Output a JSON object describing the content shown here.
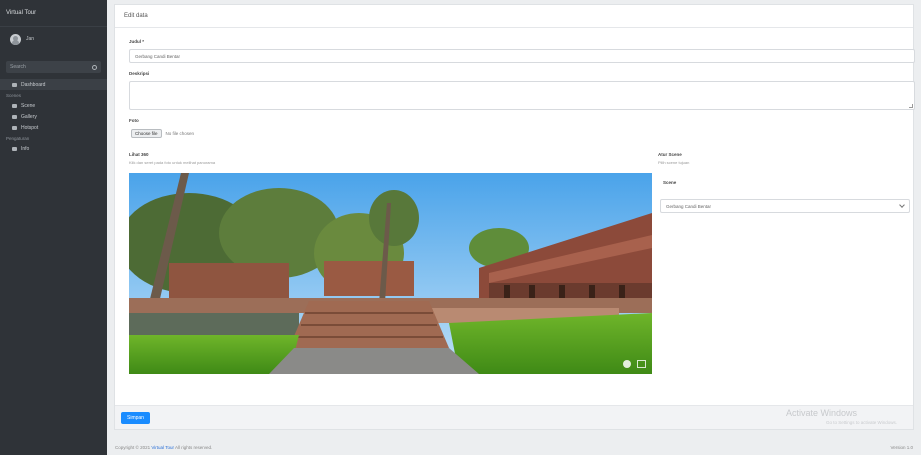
{
  "sidebar": {
    "brand": "Virtual Tour",
    "user": "Jan",
    "search_placeholder": "Search",
    "items": [
      {
        "label": "Dashboard",
        "icon": "dashboard-icon"
      },
      {
        "label": "Scenes",
        "icon": "section-heading"
      },
      {
        "label": "Scene",
        "icon": "image-icon"
      },
      {
        "label": "Gallery",
        "icon": "gallery-icon"
      },
      {
        "label": "Hotspot",
        "icon": "pin-icon"
      },
      {
        "label": "Pengaturan",
        "icon": "section-heading"
      },
      {
        "label": "Info",
        "icon": "info-icon"
      }
    ]
  },
  "card": {
    "title": "Edit data",
    "judul_label": "Judul *",
    "judul_value": "Gerbang Candi Bentar",
    "deskripsi_label": "Deskripsi",
    "foto_label": "Foto",
    "file_button": "Choose file",
    "file_text": "No file chosen",
    "preview_label": "Lihat 360",
    "preview_sub": "Klik dan seret pada foto untuk melihat panorama",
    "side_label": "Atur Scene",
    "side_sub": "Pilih scene tujuan",
    "select_label": "Scene",
    "select_value": "Gerbang Candi Bentar",
    "save_button": "Simpan"
  },
  "watermark": {
    "title": "Activate Windows",
    "subtitle": "Go to Settings to activate Windows."
  },
  "footer": {
    "prefix": "Copyright © 2021",
    "link": "Virtual Tour",
    "suffix": "All rights reserved.",
    "version": "Version 1.0"
  },
  "colors": {
    "sidebar": "#2f3338",
    "accent": "#1a8cff"
  }
}
